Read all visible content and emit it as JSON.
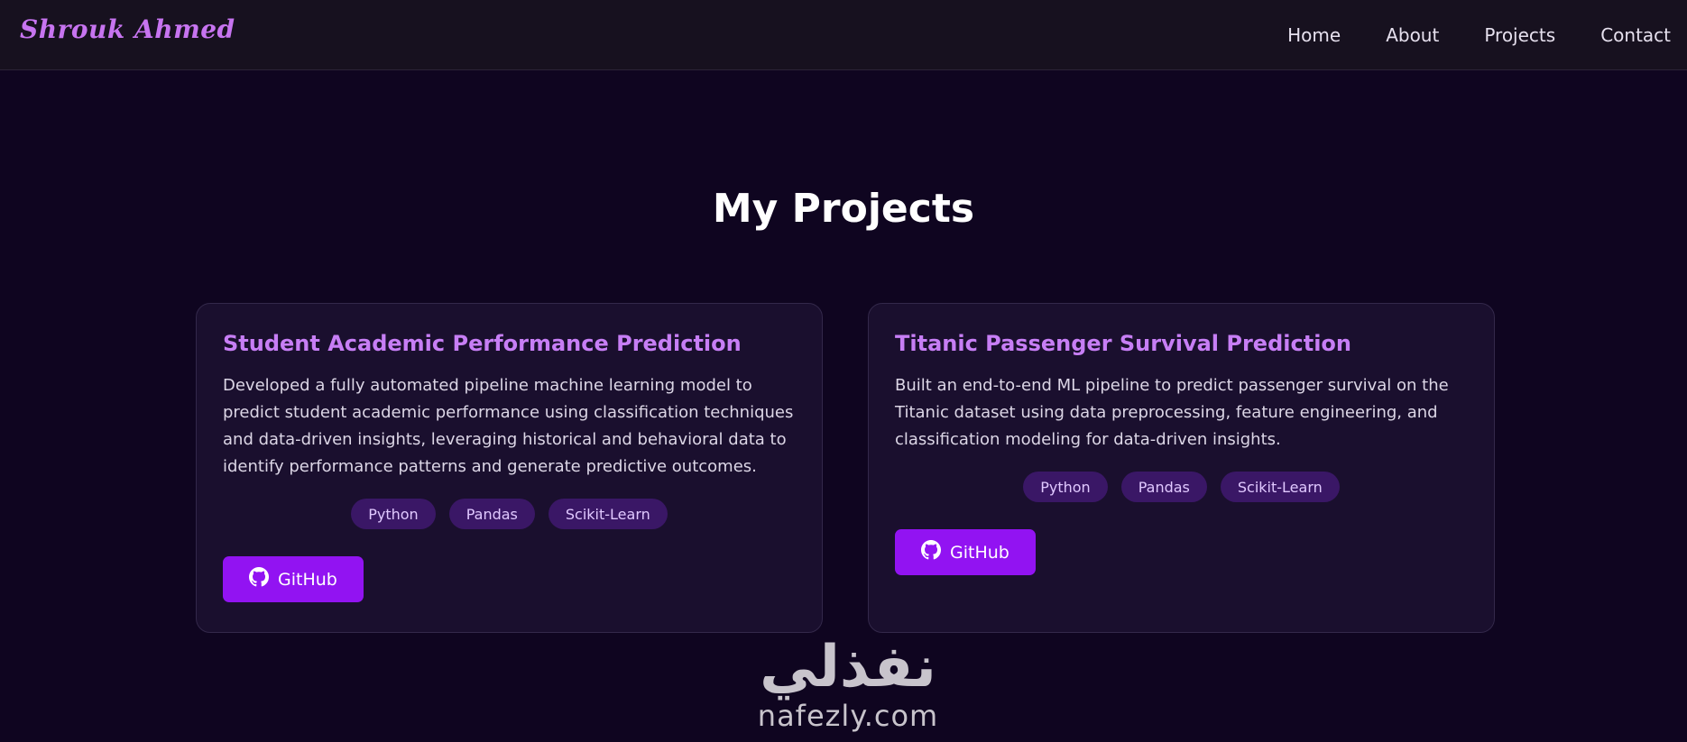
{
  "header": {
    "logo": "Shrouk Ahmed",
    "nav": [
      "Home",
      "About",
      "Projects",
      "Contact"
    ]
  },
  "main": {
    "title": "My Projects",
    "projects": [
      {
        "title": "Student Academic Performance Prediction",
        "description": "Developed a fully automated pipeline machine learning model to predict student academic performance using classification techniques and data-driven insights, leveraging historical and behavioral data to identify performance patterns and generate predictive outcomes.",
        "tags": [
          "Python",
          "Pandas",
          "Scikit-Learn"
        ],
        "button": "GitHub"
      },
      {
        "title": "Titanic Passenger Survival Prediction",
        "description": "Built an end-to-end ML pipeline to predict passenger survival on the Titanic dataset using data preprocessing, feature engineering, and classification modeling for data-driven insights.",
        "tags": [
          "Python",
          "Pandas",
          "Scikit-Learn"
        ],
        "button": "GitHub"
      }
    ]
  },
  "watermark": {
    "arabic": "نفذلي",
    "latin": "nafezly.com"
  },
  "colors": {
    "background": "#0f0520",
    "accent": "#9213f2",
    "title_accent": "#c77ef5",
    "tag_bg": "#3a1766"
  },
  "icons": {
    "github": "github-icon"
  }
}
